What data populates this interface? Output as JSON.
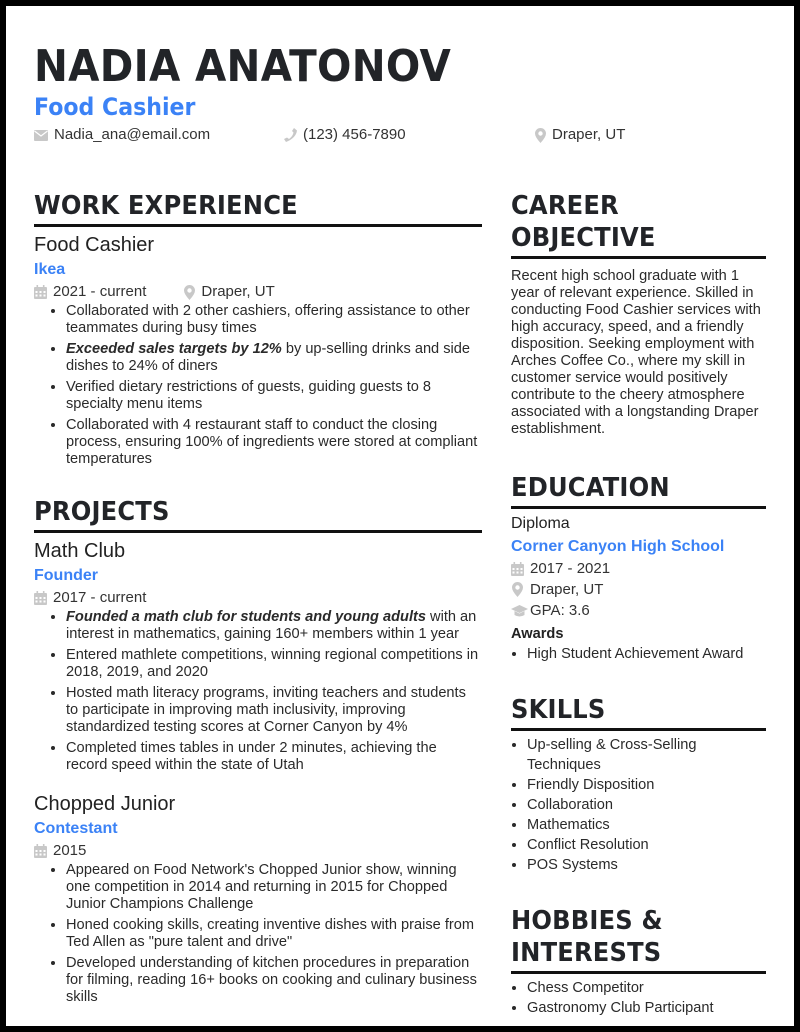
{
  "header": {
    "name": "NADIA ANATONOV",
    "role": "Food Cashier",
    "contact": {
      "email": "Nadia_ana@email.com",
      "phone": "(123) 456-7890",
      "location": "Draper, UT"
    },
    "icons": {
      "email": "envelope-icon",
      "phone": "phone-icon",
      "location": "map-pin-icon"
    }
  },
  "colors": {
    "accent": "#3b82f6",
    "text": "#2a2a2a",
    "heading": "#222428",
    "icon": "#c8c8c8"
  },
  "work_experience": {
    "title": "WORK EXPERIENCE",
    "entries": [
      {
        "position": "Food Cashier",
        "company": "Ikea",
        "dates": "2021 - current",
        "location": "Draper, UT",
        "bullets": [
          {
            "bold": "",
            "text": "Collaborated with 2 other cashiers, offering assistance to other teammates during busy times"
          },
          {
            "bold": "Exceeded sales targets by 12%",
            "text": " by up-selling drinks and side dishes to 24% of diners"
          },
          {
            "bold": "",
            "text": "Verified dietary restrictions of guests, guiding guests to 8 specialty menu items"
          },
          {
            "bold": "",
            "text": "Collaborated with 4 restaurant staff to conduct the closing process, ensuring 100% of ingredients were stored at compliant temperatures"
          }
        ]
      }
    ]
  },
  "projects": {
    "title": "PROJECTS",
    "entries": [
      {
        "name": "Math Club",
        "role": "Founder",
        "dates": "2017 - current",
        "bullets": [
          {
            "bold": "Founded a math club for students and young adults",
            "text": " with an interest in mathematics, gaining 160+ members within 1 year"
          },
          {
            "bold": "",
            "text": "Entered mathlete competitions, winning regional competitions in 2018, 2019, and 2020"
          },
          {
            "bold": "",
            "text": "Hosted math literacy programs, inviting teachers and students to participate in improving math inclusivity, improving standardized testing scores at Corner Canyon by 4%"
          },
          {
            "bold": "",
            "text": "Completed times tables in under 2 minutes, achieving the record speed within the state of Utah"
          }
        ]
      },
      {
        "name": "Chopped Junior",
        "role": "Contestant",
        "dates": "2015",
        "bullets": [
          {
            "bold": "",
            "text": "Appeared on Food Network's Chopped Junior show, winning one competition in 2014 and returning in 2015 for Chopped Junior Champions Challenge"
          },
          {
            "bold": "",
            "text": "Honed cooking skills, creating inventive dishes with praise from Ted Allen as \"pure talent and drive\""
          },
          {
            "bold": "",
            "text": "Developed understanding of kitchen procedures in preparation for filming, reading 16+ books on cooking and culinary business skills"
          }
        ]
      }
    ]
  },
  "career_objective": {
    "title": "CAREER OBJECTIVE",
    "text": "Recent high school graduate with 1 year of relevant experience. Skilled in conducting Food Cashier services with high accuracy, speed, and a friendly disposition. Seeking employment with Arches Coffee Co., where my skill in customer service would positively contribute to the cheery atmosphere associated with a longstanding Draper establishment."
  },
  "education": {
    "title": "EDUCATION",
    "degree": "Diploma",
    "school": "Corner Canyon High School",
    "dates": "2017 - 2021",
    "location": "Draper, UT",
    "gpa": "GPA: 3.6",
    "awards_label": "Awards",
    "awards": [
      "High Student Achievement Award"
    ]
  },
  "skills": {
    "title": "SKILLS",
    "items": [
      "Up-selling & Cross-Selling Techniques",
      "Friendly Disposition",
      "Collaboration",
      "Mathematics",
      "Conflict Resolution",
      "POS Systems"
    ]
  },
  "hobbies": {
    "title": "HOBBIES & INTERESTS",
    "items": [
      "Chess Competitor",
      "Gastronomy Club Participant"
    ]
  }
}
